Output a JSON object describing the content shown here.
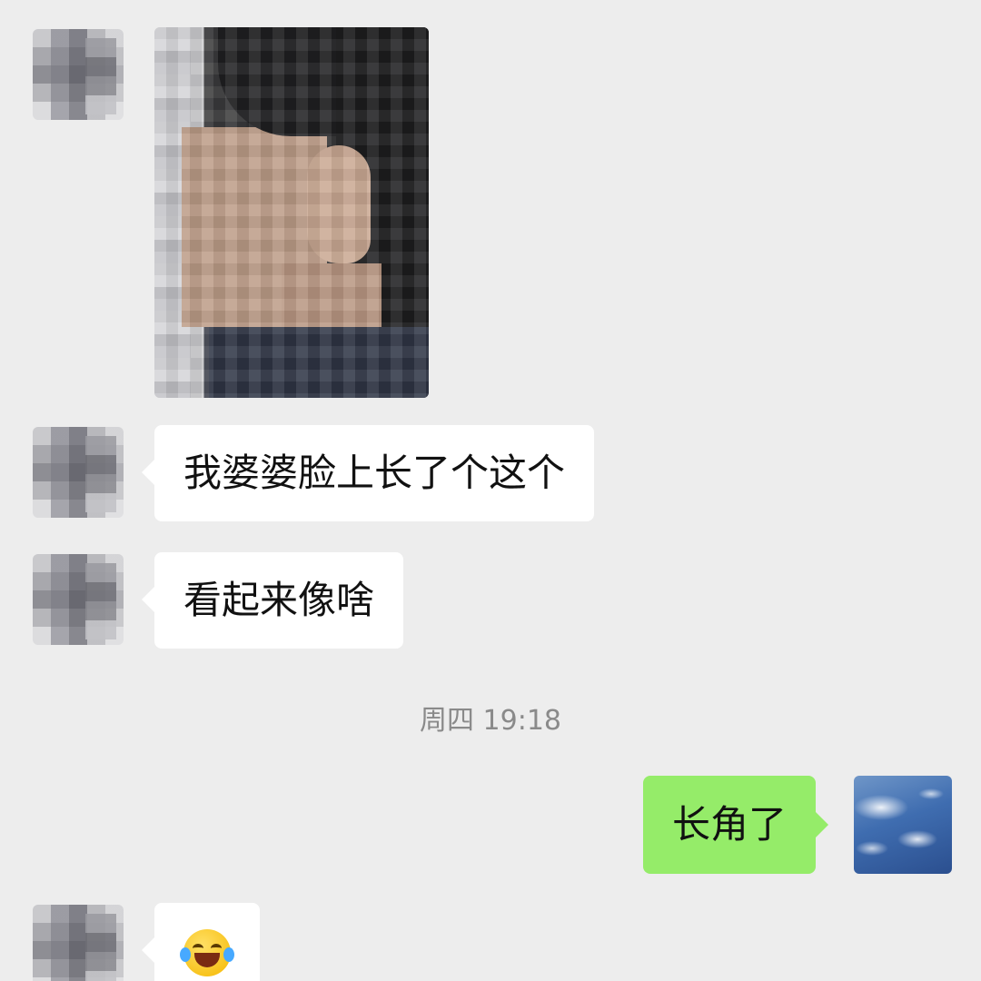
{
  "messages": [
    {
      "sender": "them",
      "type": "image",
      "image_icon": "portrait-photo-icon"
    },
    {
      "sender": "them",
      "type": "text",
      "text": "我婆婆脸上长了个这个"
    },
    {
      "sender": "them",
      "type": "text",
      "text": "看起来像啥"
    },
    {
      "sender": "me",
      "type": "text",
      "text": "长角了"
    },
    {
      "sender": "them",
      "type": "emoji",
      "emoji": "😂",
      "emoji_icon": "tears-of-joy-emoji"
    }
  ],
  "timestamp": "周四 19:18",
  "colors": {
    "background": "#ededed",
    "incoming_bubble": "#ffffff",
    "outgoing_bubble": "#95ec69",
    "timestamp_text": "#8a8a8a"
  }
}
